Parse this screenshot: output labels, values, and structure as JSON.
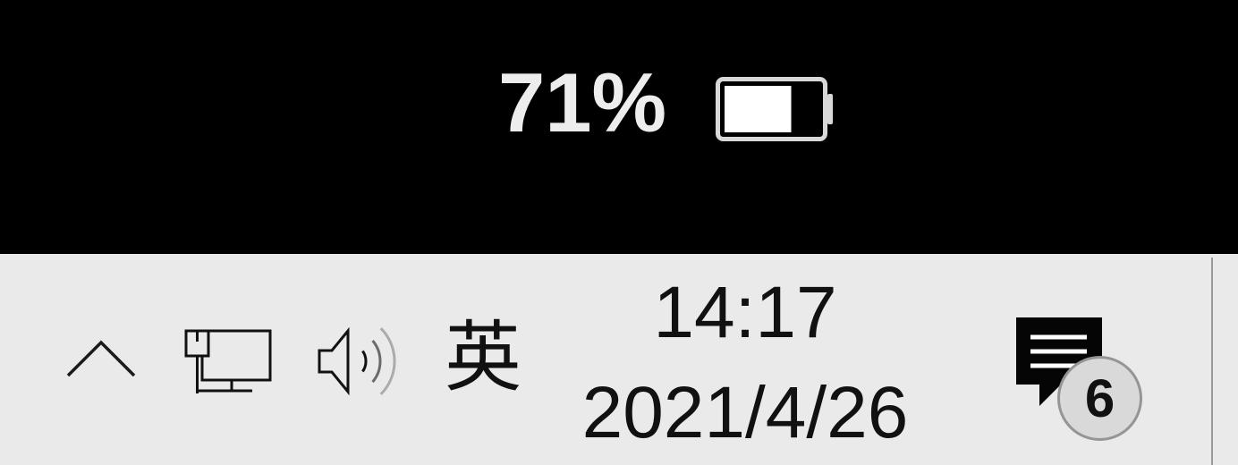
{
  "battery_flyout": {
    "percent_label": "71%",
    "level": 0.71,
    "icon": "battery-icon"
  },
  "taskbar": {
    "overflow_button": {
      "icon": "chevron-up-icon"
    },
    "network_button": {
      "icon": "ethernet-network-icon"
    },
    "volume_button": {
      "icon": "speaker-volume-icon"
    },
    "ime_button": {
      "label": "英"
    },
    "clock": {
      "time": "14:17",
      "date": "2021/4/26"
    },
    "action_center": {
      "icon": "notifications-bubble-icon",
      "badge_count": "6"
    }
  },
  "colors": {
    "flyout_background": "#000000",
    "flyout_text": "#ededed",
    "battery_fill": "#ffffff",
    "taskbar_background": "#eaeaea",
    "taskbar_text": "#111111",
    "badge_background": "#d9d9d9"
  }
}
